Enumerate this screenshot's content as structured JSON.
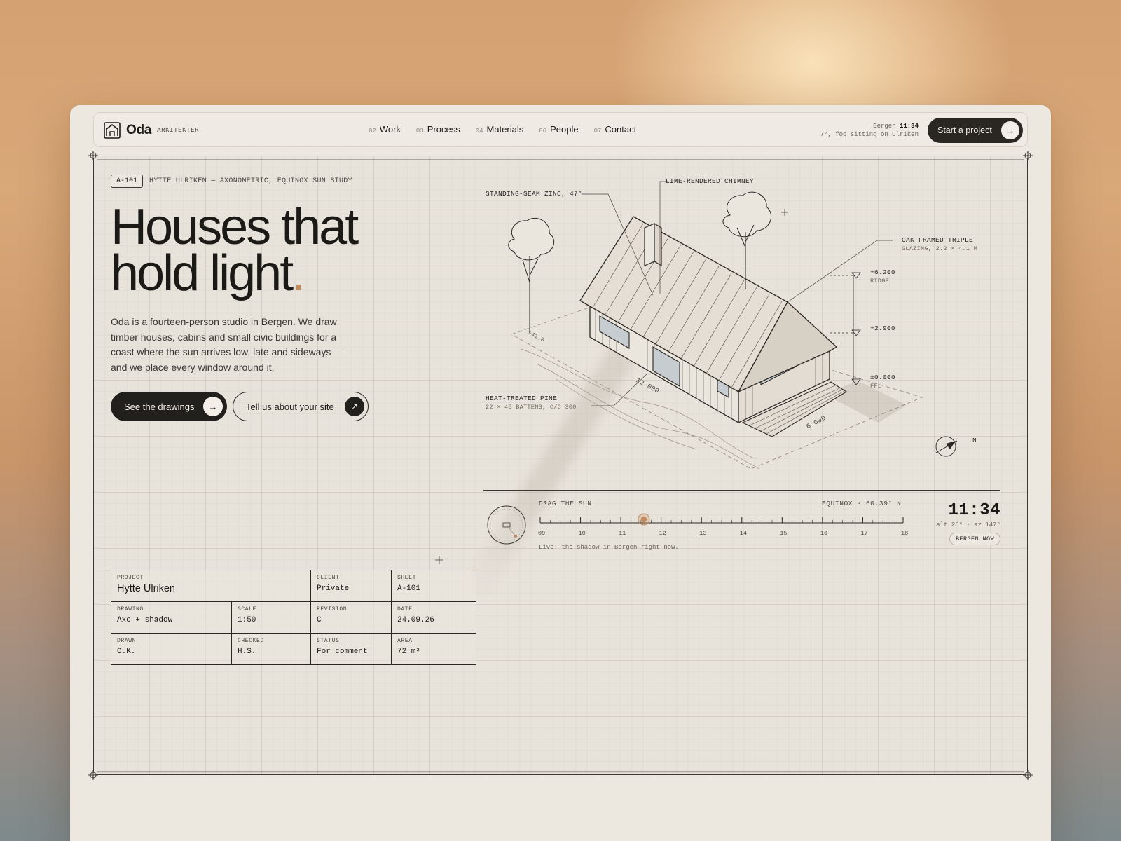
{
  "brand": {
    "name": "Oda",
    "subtitle": "ARKITEKTER"
  },
  "nav": {
    "links": [
      {
        "num": "02",
        "label": "Work"
      },
      {
        "num": "03",
        "label": "Process"
      },
      {
        "num": "04",
        "label": "Materials"
      },
      {
        "num": "06",
        "label": "People"
      },
      {
        "num": "07",
        "label": "Contact"
      }
    ],
    "status_city": "Bergen",
    "status_time": "11:34",
    "status_weather": "7°, fog sitting on Ulriken",
    "cta_label": "Start a project",
    "cta_icon": "arrow-right-icon"
  },
  "sheet": {
    "tag": "A-101",
    "caption": "HYTTE ULRIKEN — AXONOMETRIC, EQUINOX SUN STUDY",
    "headline_line1": "Houses that",
    "headline_line2": "hold light",
    "headline_dot": ".",
    "lead": "Oda is a fourteen-person studio in Bergen. We draw timber houses, cabins and small civic buildings for a coast where the sun arrives low, late and sideways — and we place every window around it.",
    "primary_button": "See the drawings",
    "secondary_button": "Tell us about your site"
  },
  "drawing": {
    "callouts": {
      "roof": "STANDING-SEAM ZINC, 47°",
      "chimney": "LIME-RENDERED CHIMNEY",
      "glazing_1": "OAK-FRAMED TRIPLE",
      "glazing_2": "GLAZING, 2.2 × 4.1 M",
      "cladding_1": "HEAT-TREATED PINE",
      "cladding_2": "22 × 48 BATTENS, C/C 300"
    },
    "levels": [
      {
        "value": "+6.200",
        "label": "RIDGE"
      },
      {
        "value": "+2.900",
        "label": ""
      },
      {
        "value": "±0.000",
        "label": "FFL"
      }
    ],
    "dimensions": {
      "length": "12 000",
      "width": "6 000",
      "terrain": "+41.0"
    },
    "north": "N"
  },
  "sun": {
    "label": "DRAG THE SUN",
    "meta": "EQUINOX · 60.39° N",
    "hours": [
      "09",
      "10",
      "11",
      "12",
      "13",
      "14",
      "15",
      "16",
      "17",
      "18"
    ],
    "current_hour": 11.57,
    "hint": "Live: the shadow in Bergen right now.",
    "clock": "11:34",
    "altaz": "alt 25° · az 147°",
    "now_button": "BERGEN NOW",
    "accent": "#c28a5d"
  },
  "title_block": {
    "project_label": "PROJECT",
    "project_value": "Hytte Ulriken",
    "client_label": "CLIENT",
    "client_value": "Private",
    "sheet_label": "SHEET",
    "sheet_value": "A-101",
    "drawing_label": "DRAWING",
    "drawing_value": "Axo + shadow",
    "scale_label": "SCALE",
    "scale_value": "1:50",
    "revision_label": "REVISION",
    "revision_value": "C",
    "date_label": "DATE",
    "date_value": "24.09.26",
    "drawn_label": "DRAWN",
    "drawn_value": "O.K.",
    "checked_label": "CHECKED",
    "checked_value": "H.S.",
    "status_label": "STATUS",
    "status_value": "For comment",
    "area_label": "AREA",
    "area_value": "72 m²"
  }
}
